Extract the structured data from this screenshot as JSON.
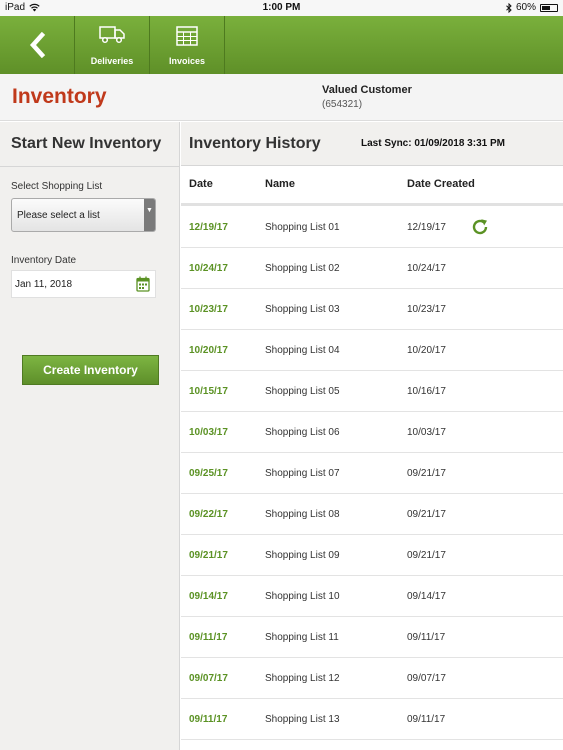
{
  "status_bar": {
    "device": "iPad",
    "time": "1:00 PM",
    "battery": "60%",
    "battery_level": 0.6
  },
  "toolbar": {
    "buttons": [
      {
        "label": "Deliveries",
        "icon": "truck-icon"
      },
      {
        "label": "Invoices",
        "icon": "invoice-grid-icon"
      }
    ]
  },
  "header": {
    "title": "Inventory",
    "customer_name": "Valued Customer",
    "customer_id": "(654321)"
  },
  "new_inventory": {
    "title": "Start New Inventory",
    "shopping_list_label": "Select Shopping List",
    "shopping_list_value": "Please select a list",
    "date_label": "Inventory Date",
    "date_value": "Jan 11, 2018",
    "create_label": "Create Inventory"
  },
  "history": {
    "title": "Inventory History",
    "last_sync": "Last Sync: 01/09/2018 3:31 PM",
    "columns": [
      "Date",
      "Name",
      "Date Created"
    ],
    "rows": [
      {
        "date": "12/19/17",
        "name": "Shopping List 01",
        "created": "12/19/17",
        "sync_icon": true
      },
      {
        "date": "10/24/17",
        "name": "Shopping List 02",
        "created": "10/24/17"
      },
      {
        "date": "10/23/17",
        "name": "Shopping List 03",
        "created": "10/23/17"
      },
      {
        "date": "10/20/17",
        "name": "Shopping List 04",
        "created": "10/20/17"
      },
      {
        "date": "10/15/17",
        "name": "Shopping List 05",
        "created": "10/16/17"
      },
      {
        "date": "10/03/17",
        "name": "Shopping List 06",
        "created": "10/03/17"
      },
      {
        "date": "09/25/17",
        "name": "Shopping List 07",
        "created": "09/21/17"
      },
      {
        "date": "09/22/17",
        "name": "Shopping List 08",
        "created": "09/21/17"
      },
      {
        "date": "09/21/17",
        "name": "Shopping List 09",
        "created": "09/21/17"
      },
      {
        "date": "09/14/17",
        "name": "Shopping List 10",
        "created": "09/14/17"
      },
      {
        "date": "09/11/17",
        "name": "Shopping List 11",
        "created": "09/11/17"
      },
      {
        "date": "09/07/17",
        "name": "Shopping List 12",
        "created": "09/07/17"
      },
      {
        "date": "09/11/17",
        "name": "Shopping List 13",
        "created": "09/11/17"
      }
    ]
  },
  "colors": {
    "toolbar_green": "#6fa334",
    "title_red": "#c0391b",
    "date_green": "#5b9224",
    "panel_grey": "#f1f0ee"
  }
}
